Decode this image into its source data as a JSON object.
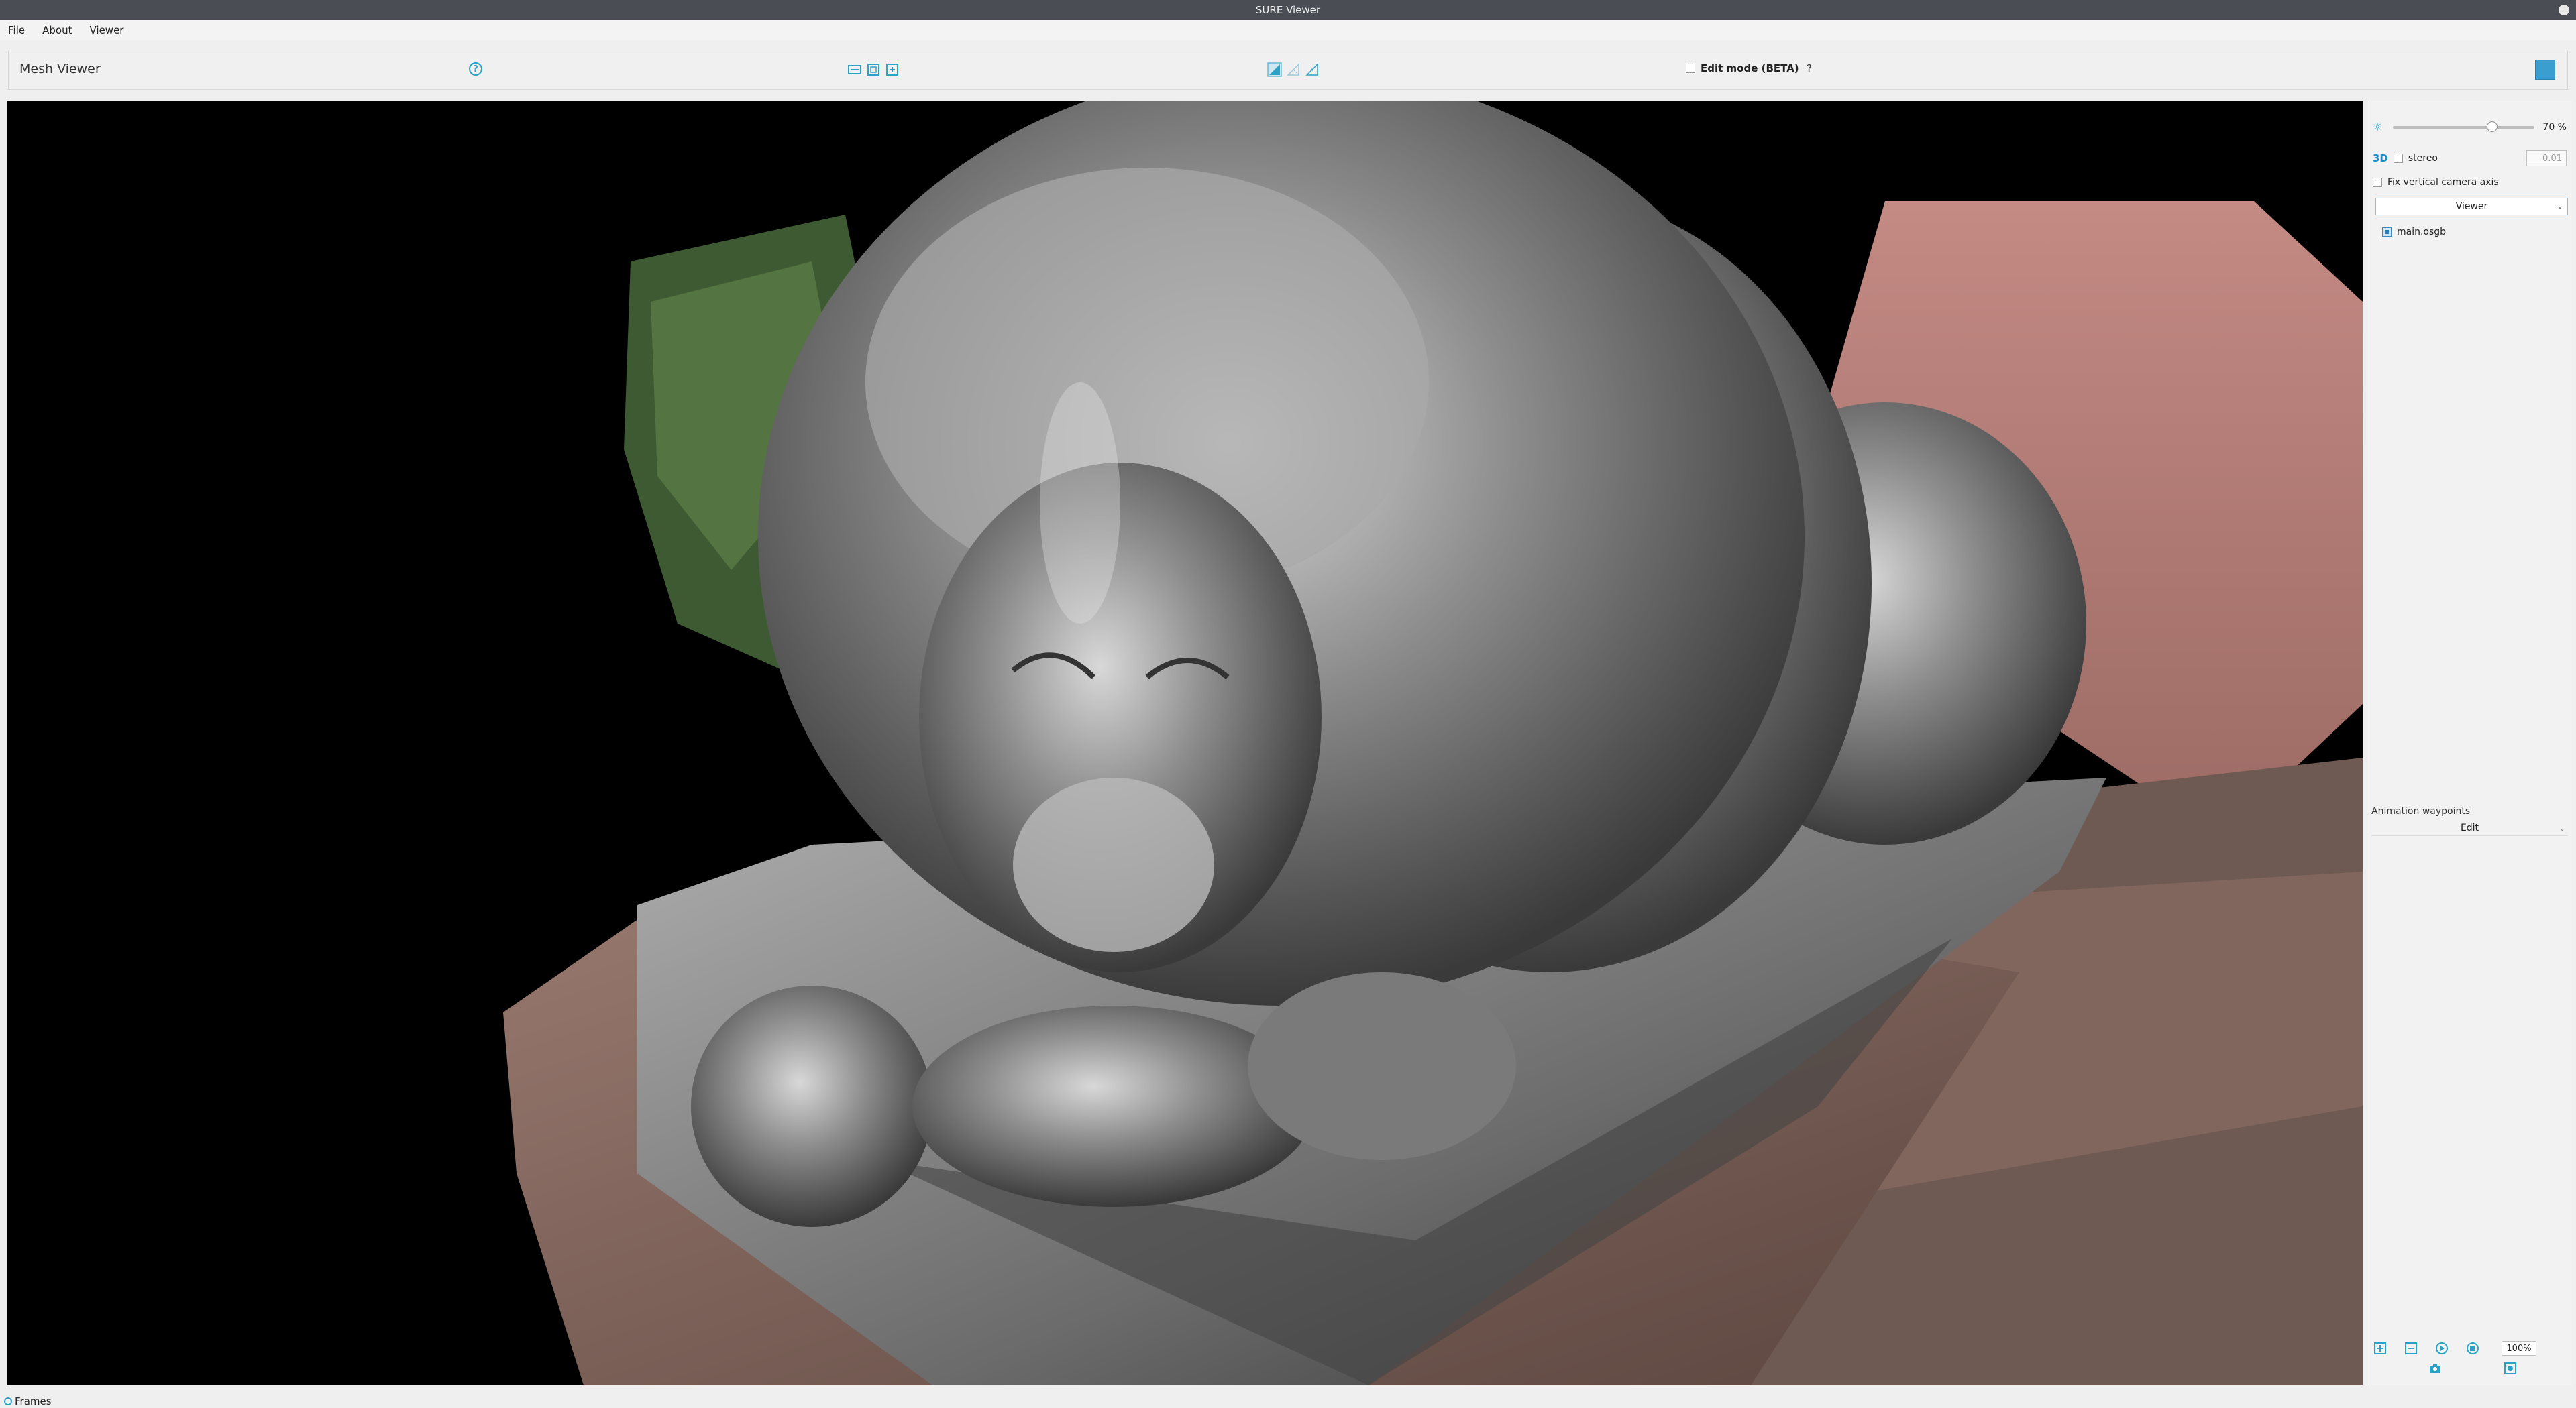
{
  "window": {
    "title": "SURE Viewer"
  },
  "menu": {
    "items": [
      "File",
      "About",
      "Viewer"
    ]
  },
  "toolbar": {
    "title": "Mesh Viewer",
    "help_label": "?",
    "edit_mode_label": "Edit mode (BETA)",
    "edit_mode_checked": false,
    "edit_help": "?"
  },
  "panel": {
    "brightness_value": 70,
    "brightness_label": "70 %",
    "threed_label": "3D",
    "stereo_label": "stereo",
    "stereo_checked": false,
    "stereo_value": "0.01",
    "fix_axis_label": "Fix vertical camera axis",
    "fix_axis_checked": false,
    "viewer_select": "Viewer",
    "layers": [
      {
        "name": "main.osgb",
        "checked": true
      }
    ],
    "animation_label": "Animation waypoints",
    "animation_edit": "Edit",
    "zoom_value": "100%"
  },
  "status": {
    "text": "Frames"
  },
  "colors": {
    "accent": "#2aa3c6",
    "titlebar": "#4a4e54",
    "viewport_bg": "#000000"
  },
  "icons": {
    "toolbar": [
      "fit-width-icon",
      "fit-frame-icon",
      "fit-all-icon",
      "render-shaded-icon",
      "render-wireframe-icon",
      "render-points-icon",
      "panel-toggle-icon"
    ],
    "bottom": [
      "add-waypoint-icon",
      "remove-waypoint-icon",
      "play-icon",
      "record-icon",
      "camera-icon",
      "snapshot-icon"
    ]
  }
}
